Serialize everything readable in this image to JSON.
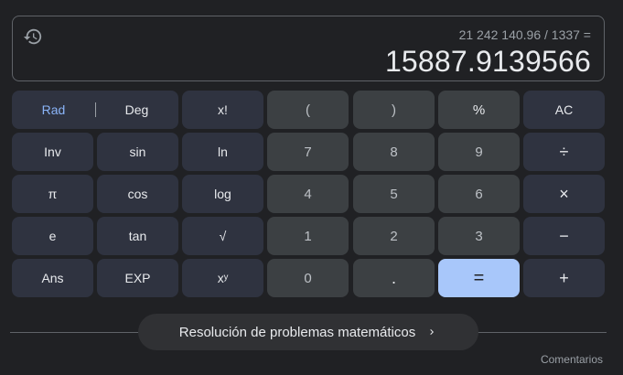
{
  "display": {
    "history_icon": "history-icon",
    "expression": "21 242 140.96 / 1337 =",
    "result": "15887.9139566"
  },
  "mode": {
    "rad_label": "Rad",
    "deg_label": "Deg",
    "active": "Rad"
  },
  "keys": {
    "factorial": "x!",
    "paren_open": "(",
    "paren_close": ")",
    "percent": "%",
    "clear": "AC",
    "inv": "Inv",
    "sin": "sin",
    "ln": "ln",
    "seven": "7",
    "eight": "8",
    "nine": "9",
    "divide": "÷",
    "pi": "π",
    "cos": "cos",
    "log": "log",
    "four": "4",
    "five": "5",
    "six": "6",
    "multiply": "×",
    "e": "e",
    "tan": "tan",
    "sqrt": "√",
    "one": "1",
    "two": "2",
    "three": "3",
    "minus": "−",
    "ans": "Ans",
    "exp": "EXP",
    "power": "xʸ",
    "zero": "0",
    "dot": ".",
    "equals": "=",
    "plus": "+"
  },
  "solver": {
    "label": "Resolución de problemas matemáticos",
    "icon": "chevron-right-icon"
  },
  "feedback_label": "Comentarios",
  "colors": {
    "background": "#202124",
    "function_key": "#2f3340",
    "number_key": "#3c4043",
    "equals_key": "#a8c7fa",
    "accent": "#8ab4f8"
  }
}
